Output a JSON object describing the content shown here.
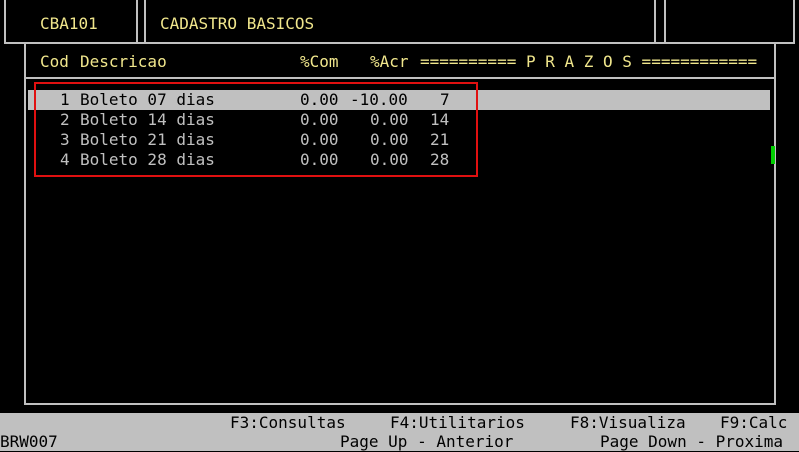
{
  "header": {
    "program_code": "CBA101",
    "title": "CADASTRO BASICOS"
  },
  "table": {
    "columns": {
      "cod": "Cod",
      "descricao": "Descricao",
      "com": "%Com",
      "acr": "%Acr",
      "prazos": "========== P R A Z O S ============"
    },
    "selection_marker": "ú",
    "rows": [
      {
        "cod": "1",
        "descricao": "Boleto 07 dias",
        "com": "0.00",
        "acr": "-10.00",
        "prazo": "7"
      },
      {
        "cod": "2",
        "descricao": "Boleto 14 dias",
        "com": "0.00",
        "acr": "0.00",
        "prazo": "14"
      },
      {
        "cod": "3",
        "descricao": "Boleto 21 dias",
        "com": "0.00",
        "acr": "0.00",
        "prazo": "21"
      },
      {
        "cod": "4",
        "descricao": "Boleto 28 dias",
        "com": "0.00",
        "acr": "0.00",
        "prazo": "28"
      }
    ]
  },
  "footer": {
    "f3": "F3:Consultas",
    "f4": "F4:Utilitarios",
    "f8": "F8:Visualiza",
    "f9": "F9:Calc",
    "screen_id": "BRW007",
    "page_up": "Page Up - Anterior",
    "page_down": "Page Down - Proxima"
  },
  "colors": {
    "background": "#000000",
    "header_text": "#f0e68c",
    "body_text": "#c0c0c0",
    "highlight": "#c0c0c0",
    "annotation": "#e01010",
    "scroll_indicator": "#00d000"
  }
}
